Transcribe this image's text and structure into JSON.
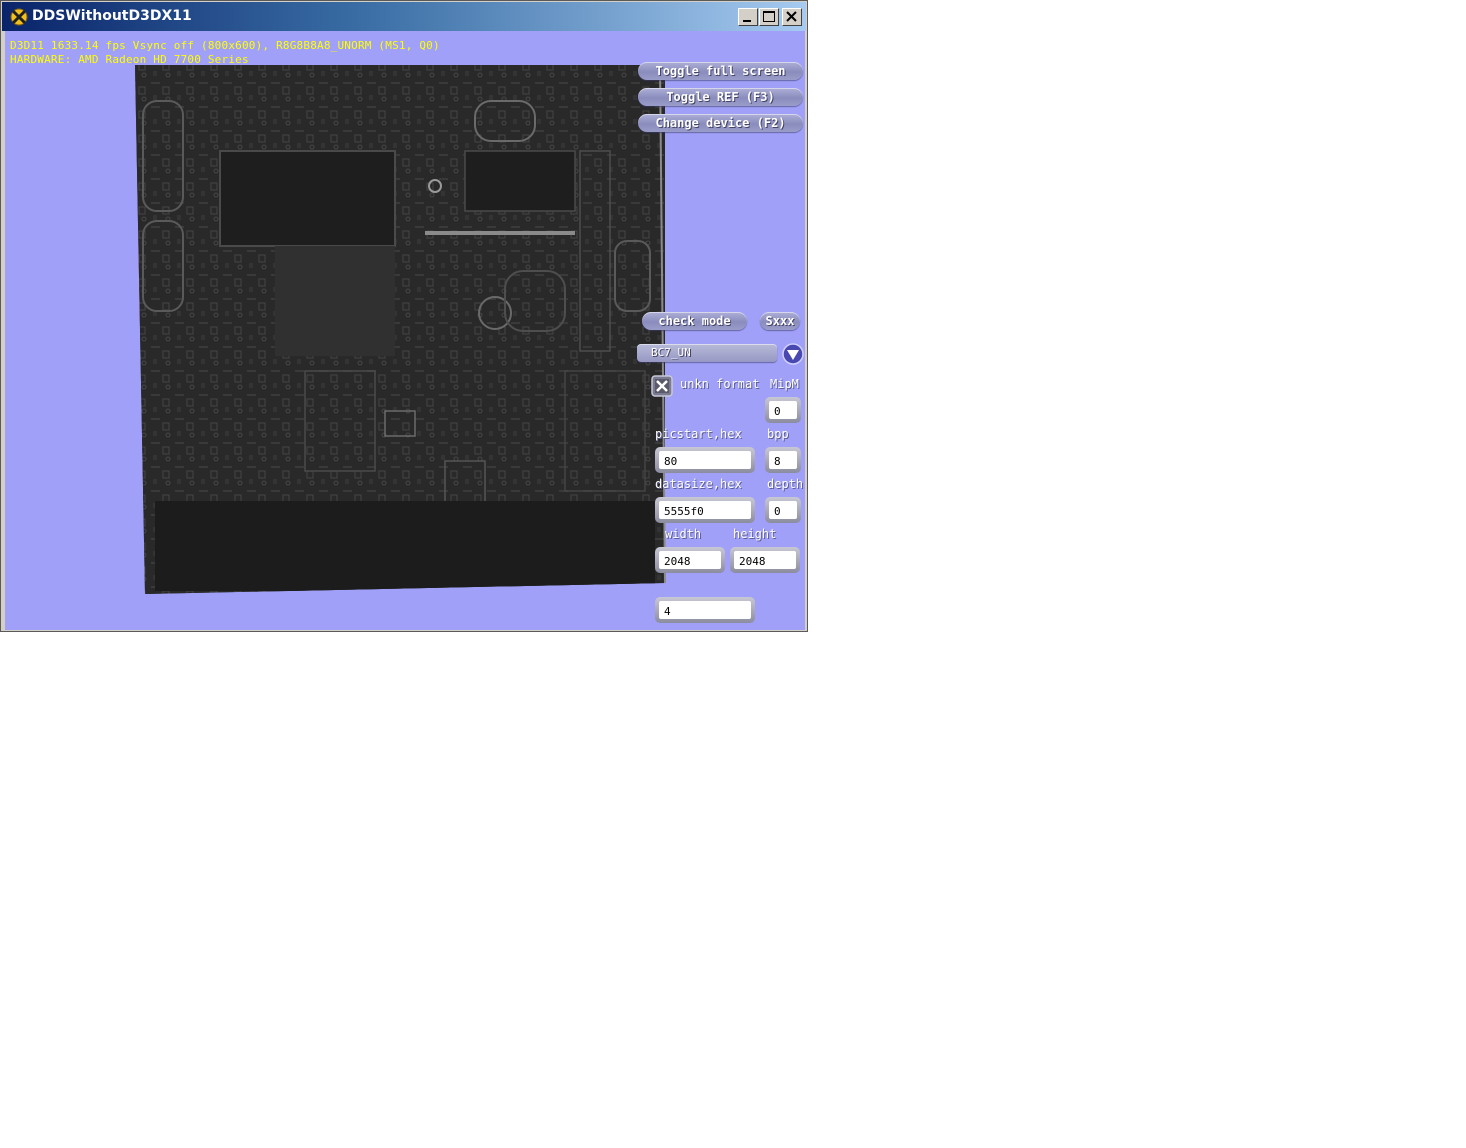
{
  "window": {
    "title": "DDSWithoutD3DX11"
  },
  "hud": {
    "line1": "D3D11 1633.14 fps Vsync off (800x600), R8G8B8A8_UNORM (MS1, Q0)",
    "line2": "HARDWARE: AMD Radeon HD 7700 Series",
    "text_color": "#ffff00"
  },
  "client": {
    "background": "#a0a0f8"
  },
  "buttons": {
    "toggle_full_screen": "Toggle full screen",
    "toggle_ref": "Toggle REF (F3)",
    "change_device": "Change device (F2)",
    "check_mode": "check mode",
    "swizzle": "Sxxx"
  },
  "format_combo": {
    "selected": "BC7_UN"
  },
  "unkn_format": {
    "label": "unkn format",
    "checked": true
  },
  "labels": {
    "mipm": "MipM",
    "picstart": "picstart,hex",
    "bpp": "bpp",
    "datasize": "datasize,hex",
    "depth": "depth",
    "width": "width",
    "height": "height"
  },
  "fields": {
    "mipm": "0",
    "picstart": "80",
    "bpp": "8",
    "datasize": "5555f0",
    "depth": "0",
    "width": "2048",
    "height": "2048",
    "extra": "4"
  }
}
